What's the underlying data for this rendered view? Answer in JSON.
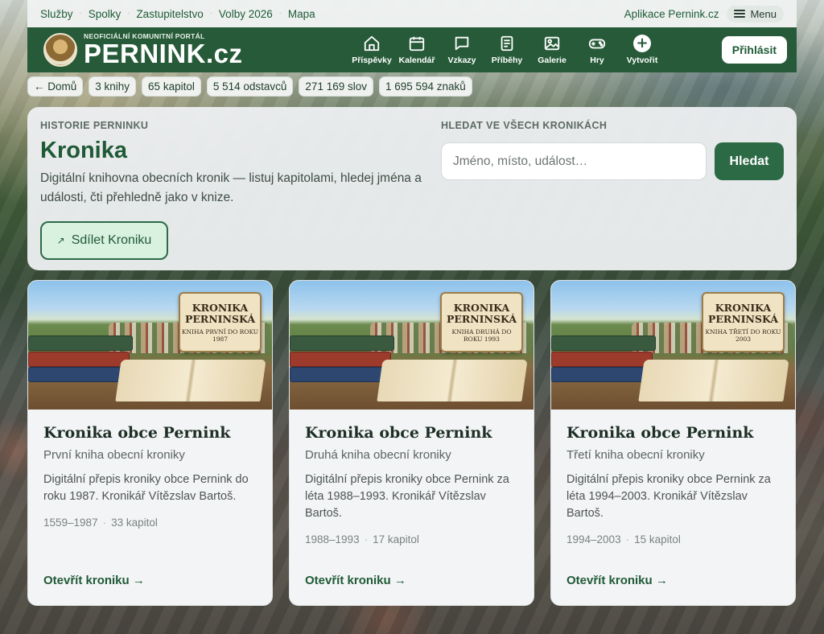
{
  "topbar": {
    "links": [
      "Služby",
      "Spolky",
      "Zastupitelstvo",
      "Volby 2026",
      "Mapa"
    ],
    "app_link": "Aplikace Pernink.cz",
    "menu_label": "Menu"
  },
  "header": {
    "tagline": "NEOFICIÁLNÍ KOMUNITNÍ PORTÁL",
    "site_name": "PERNINK.cz",
    "nav": [
      {
        "label": "Příspěvky",
        "icon": "home-icon"
      },
      {
        "label": "Kalendář",
        "icon": "calendar-icon"
      },
      {
        "label": "Vzkazy",
        "icon": "message-icon"
      },
      {
        "label": "Příběhy",
        "icon": "document-icon"
      },
      {
        "label": "Galerie",
        "icon": "image-icon"
      },
      {
        "label": "Hry",
        "icon": "gamepad-icon"
      },
      {
        "label": "Vytvořit",
        "icon": "plus-icon"
      }
    ],
    "login_label": "Přihlásit"
  },
  "stats": {
    "back": "← Domů",
    "books": "3 knihy",
    "chapters": "65 kapitol",
    "paragraphs": "5 514 odstavců",
    "words": "271 169 slov",
    "chars": "1 695 594 znaků"
  },
  "hero": {
    "eyebrow": "HISTORIE PERNINKU",
    "title": "Kronika",
    "description": "Digitální knihovna obecních kronik — listuj kapitolami, hledej jména a události, čti přehledně jako v knize.",
    "share_label": "Sdílet Kroniku"
  },
  "search": {
    "label": "HLEDAT VE VŠECH KRONIKÁCH",
    "placeholder": "Jméno, místo, událost…",
    "button": "Hledat"
  },
  "cards": [
    {
      "cover_title": "KRONIKA PERNINSKÁ",
      "cover_sub": "KNIHA PRVNÍ DO ROKU 1987",
      "title": "Kronika obce Pernink",
      "subtitle": "První kniha obecní kroniky",
      "description": "Digitální přepis kroniky obce Pernink do roku 1987. Kronikář Vítězslav Bartoš.",
      "years": "1559–1987",
      "chapters": "33 kapitol",
      "link": "Otevřít kroniku →"
    },
    {
      "cover_title": "KRONIKA PERNINSKÁ",
      "cover_sub": "KNIHA DRUHÁ DO ROKU 1993",
      "title": "Kronika obce Pernink",
      "subtitle": "Druhá kniha obecní kroniky",
      "description": "Digitální přepis kroniky obce Pernink za léta 1988–1993. Kronikář Vítězslav Bartoš.",
      "years": "1988–1993",
      "chapters": "17 kapitol",
      "link": "Otevřít kroniku →"
    },
    {
      "cover_title": "KRONIKA PERNINSKÁ",
      "cover_sub": "KNIHA TŘETÍ DO ROKU 2003",
      "title": "Kronika obce Pernink",
      "subtitle": "Třetí kniha obecní kroniky",
      "description": "Digitální přepis kroniky obce Pernink za léta 1994–2003. Kronikář Vítězslav Bartoš.",
      "years": "1994–2003",
      "chapters": "15 kapitol",
      "link": "Otevřít kroniku →"
    }
  ],
  "colors": {
    "brand_green": "#265a38",
    "accent_green": "#2b6a44",
    "share_bg": "#d9f1df"
  }
}
